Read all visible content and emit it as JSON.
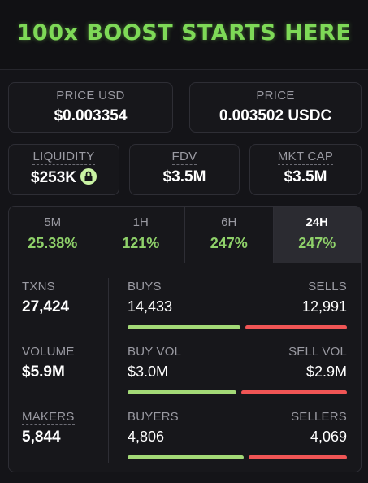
{
  "banner": {
    "text": "100x BOOST STARTS HERE"
  },
  "price_usd": {
    "label": "PRICE USD",
    "value": "$0.003354"
  },
  "price": {
    "label": "PRICE",
    "value": "0.003502 USDC"
  },
  "liquidity": {
    "label": "LIQUIDITY",
    "value": "$253K"
  },
  "fdv": {
    "label": "FDV",
    "value": "$3.5M"
  },
  "mkt_cap": {
    "label": "MKT CAP",
    "value": "$3.5M"
  },
  "timeframes": [
    {
      "label": "5M",
      "value": "25.38%"
    },
    {
      "label": "1H",
      "value": "121%"
    },
    {
      "label": "6H",
      "value": "247%"
    },
    {
      "label": "24H",
      "value": "247%"
    }
  ],
  "active_timeframe": "24H",
  "stats": {
    "txns": {
      "label": "TXNS",
      "value": "27,424"
    },
    "volume": {
      "label": "VOLUME",
      "value": "$5.9M"
    },
    "makers": {
      "label": "MAKERS",
      "value": "5,844"
    }
  },
  "buys_sells": {
    "left_label": "BUYS",
    "left_value": "14,433",
    "right_label": "SELLS",
    "right_value": "12,991",
    "buy_share": 0.526
  },
  "vol": {
    "left_label": "BUY VOL",
    "left_value": "$3.0M",
    "right_label": "SELL VOL",
    "right_value": "$2.9M",
    "buy_share": 0.508
  },
  "buyers_sellers": {
    "left_label": "BUYERS",
    "left_value": "4,806",
    "right_label": "SELLERS",
    "right_value": "4,069",
    "buy_share": 0.542
  },
  "colors": {
    "banner_green": "#7ed957",
    "positive_green": "#8fd16a",
    "buy_bar": "#a3d977",
    "sell_bar": "#f05555"
  }
}
